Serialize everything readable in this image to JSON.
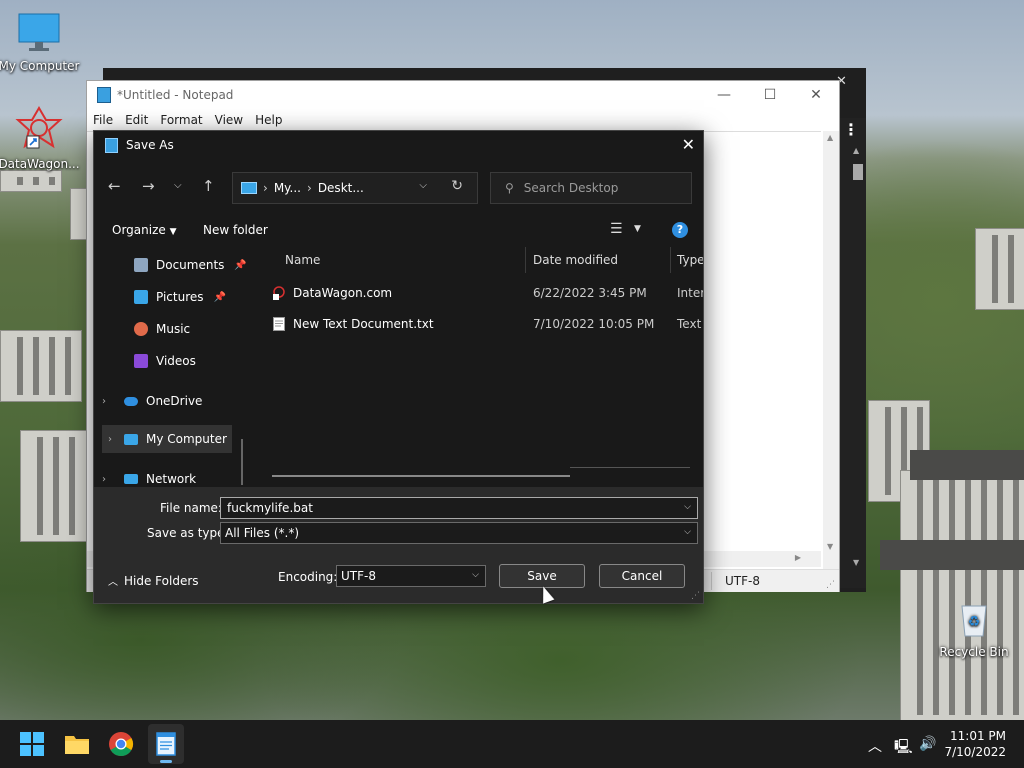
{
  "desktop": {
    "icons": [
      {
        "label": "My Computer",
        "icon": "monitor-icon"
      },
      {
        "label": "DataWagon...",
        "icon": "datawagon-icon"
      },
      {
        "label": "Recycle Bin",
        "icon": "recycle-bin-icon"
      }
    ]
  },
  "notepad": {
    "title": "*Untitled - Notepad",
    "menu": [
      "File",
      "Edit",
      "Format",
      "View",
      "Help"
    ],
    "status_encoding": "UTF-8"
  },
  "dialog": {
    "title": "Save As",
    "address": {
      "crumbs": [
        "My...",
        "Deskt..."
      ]
    },
    "search": {
      "placeholder": "Search Desktop"
    },
    "toolbar": {
      "organize": "Organize",
      "new_folder": "New folder",
      "help": "?"
    },
    "nav": {
      "items": [
        {
          "label": "Documents",
          "pinned": true
        },
        {
          "label": "Pictures",
          "pinned": true
        },
        {
          "label": "Music"
        },
        {
          "label": "Videos"
        },
        {
          "label": "OneDrive"
        },
        {
          "label": "My Computer"
        },
        {
          "label": "Network"
        }
      ]
    },
    "columns": {
      "name": "Name",
      "date": "Date modified",
      "type": "Type"
    },
    "files": [
      {
        "name": "DataWagon.com",
        "date": "6/22/2022 3:45 PM",
        "type": "Intern"
      },
      {
        "name": "New Text Document.txt",
        "date": "7/10/2022 10:05 PM",
        "type": "Text D"
      }
    ],
    "form": {
      "file_name_label": "File name:",
      "file_name_value": "fuckmylife.bat",
      "save_type_label": "Save as type:",
      "save_type_value": "All Files  (*.*)",
      "encoding_label": "Encoding:",
      "encoding_value": "UTF-8",
      "save": "Save",
      "cancel": "Cancel",
      "hide_folders": "Hide Folders"
    }
  },
  "taskbar": {
    "time": "11:01 PM",
    "date": "7/10/2022"
  },
  "colors": {
    "accent": "#2f8fe0",
    "dialog_bg": "#191919",
    "dialog_bottom": "#2b2b2b",
    "taskbar": "#1c1c1c"
  }
}
